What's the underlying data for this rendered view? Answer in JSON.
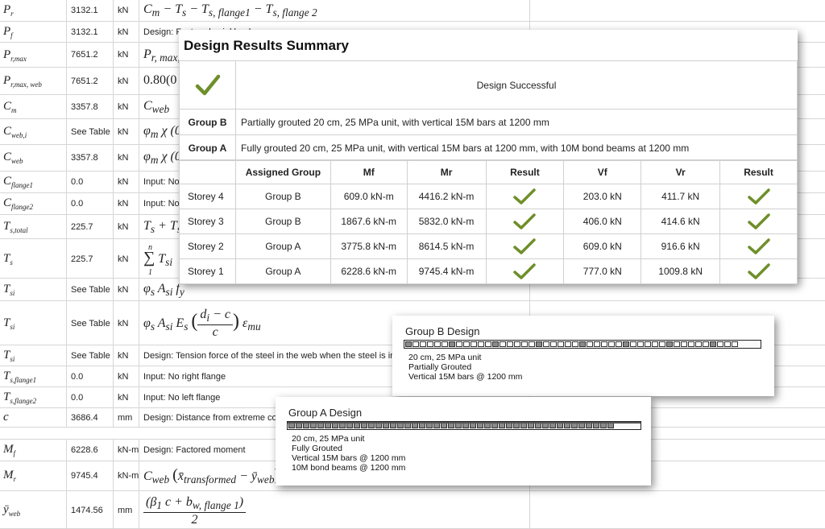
{
  "calc_sheet": {
    "rows": [
      {
        "sym": "P",
        "sub": "r",
        "value": "3132.1",
        "unit": "kN",
        "eq": "C_m − T_s − T_s,flange1 − T_s,flange2"
      },
      {
        "sym": "P",
        "sub": "f",
        "value": "3132.1",
        "unit": "kN",
        "eq": "Design: Factored axial load"
      },
      {
        "sym": "P",
        "sub": "r,max",
        "value": "7651.2",
        "unit": "kN",
        "eq": "P_r,max,w"
      },
      {
        "sym": "P",
        "sub": "r,max, web",
        "value": "7651.2",
        "unit": "kN",
        "eq": "0.80(0"
      },
      {
        "sym": "C",
        "sub": "m",
        "value": "3357.8",
        "unit": "kN",
        "eq": "C_web"
      },
      {
        "sym": "C",
        "sub": "web,i",
        "value": "See Table",
        "unit": "kN",
        "eq": "φ_m χ (0"
      },
      {
        "sym": "C",
        "sub": "web",
        "value": "3357.8",
        "unit": "kN",
        "eq": "φ_m χ (0"
      },
      {
        "sym": "C",
        "sub": "flange1",
        "value": "0.0",
        "unit": "kN",
        "eq": "Input: No"
      },
      {
        "sym": "C",
        "sub": "flange2",
        "value": "0.0",
        "unit": "kN",
        "eq": "Input: No"
      },
      {
        "sym": "T",
        "sub": "s,total",
        "value": "225.7",
        "unit": "kN",
        "eq": "T_s + T_s"
      },
      {
        "sym": "T",
        "sub": "s",
        "value": "225.7",
        "unit": "kN",
        "eq": "Σ T_si"
      },
      {
        "sym": "T",
        "sub": "si",
        "value": "See Table",
        "unit": "kN",
        "eq": "φ_s A_si f_y"
      },
      {
        "sym": "T",
        "sub": "si",
        "value": "See Table",
        "unit": "kN",
        "eq": "φ_s A_si E_s ((d_i − c)/c) ε_mu"
      },
      {
        "sym": "T",
        "sub": "si",
        "value": "See Table",
        "unit": "kN",
        "eq": "Design: Tension force of the steel in the web when the steel is in c"
      },
      {
        "sym": "T",
        "sub": "s,flange1",
        "value": "0.0",
        "unit": "kN",
        "eq": "Input: No right flange"
      },
      {
        "sym": "T",
        "sub": "s,flange2",
        "value": "0.0",
        "unit": "kN",
        "eq": "Input: No left flange"
      },
      {
        "sym": "c",
        "sub": "",
        "value": "3686.4",
        "unit": "mm",
        "eq": "Design: Distance from extreme com"
      },
      {
        "sym": "M",
        "sub": "f",
        "value": "6228.6",
        "unit": "kN-m",
        "eq": "Design: Factored moment"
      },
      {
        "sym": "M",
        "sub": "r",
        "value": "9745.4",
        "unit": "kN-m",
        "eq": "C_web (x̄_transformed − ȳ_web) + Σ"
      },
      {
        "sym": "ȳ",
        "sub": "web",
        "value": "1474.56",
        "unit": "mm",
        "eq": "(β1 c + b_w,flange1) / 2"
      }
    ]
  },
  "summary": {
    "title": "Design Results Summary",
    "status": "Design Successful",
    "groups": [
      {
        "label": "Group B",
        "desc": "Partially grouted 20 cm, 25 MPa unit, with vertical 15M bars at 1200 mm"
      },
      {
        "label": "Group A",
        "desc": "Fully grouted 20 cm, 25 MPa unit, with vertical 15M bars at 1200 mm, with 10M bond beams at 1200 mm"
      }
    ],
    "columns": [
      "",
      "Assigned Group",
      "Mf",
      "Mr",
      "Result",
      "Vf",
      "Vr",
      "Result"
    ],
    "rows": [
      {
        "storey": "Storey 4",
        "group": "Group B",
        "mf": "609.0 kN-m",
        "mr": "4416.2 kN-m",
        "vf": "203.0 kN",
        "vr": "411.7 kN"
      },
      {
        "storey": "Storey 3",
        "group": "Group B",
        "mf": "1867.6 kN-m",
        "mr": "5832.0 kN-m",
        "vf": "406.0 kN",
        "vr": "414.6 kN"
      },
      {
        "storey": "Storey 2",
        "group": "Group A",
        "mf": "3775.8 kN-m",
        "mr": "8614.5 kN-m",
        "vf": "609.0 kN",
        "vr": "916.6 kN"
      },
      {
        "storey": "Storey 1",
        "group": "Group A",
        "mf": "6228.6 kN-m",
        "mr": "9745.4 kN-m",
        "vf": "777.0 kN",
        "vr": "1009.8 kN"
      }
    ],
    "check_color": "#6e8f2a"
  },
  "group_b_design": {
    "title": "Group B Design",
    "lines": [
      "20 cm, 25 MPa unit",
      "Partially Grouted",
      "Vertical 15M bars @ 1200 mm"
    ]
  },
  "group_a_design": {
    "title": "Group A Design",
    "lines": [
      "20 cm, 25 MPa unit",
      "Fully Grouted",
      "Vertical 15M bars @ 1200 mm",
      "10M bond beams @ 1200 mm"
    ]
  }
}
